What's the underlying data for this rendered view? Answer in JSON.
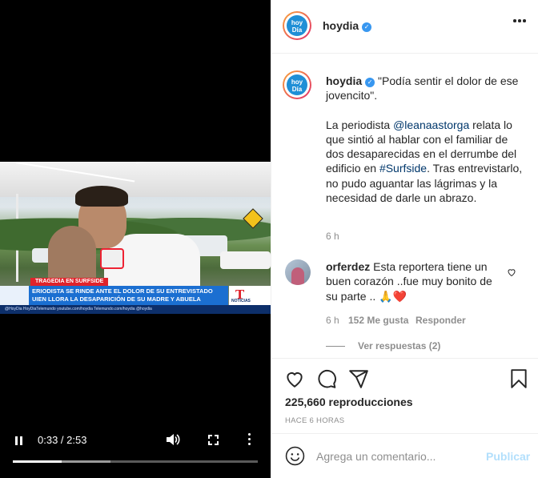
{
  "video": {
    "tag": "TRAGEDIA EN SURFSIDE",
    "headline_1": "ERIODISTA SE RINDE ANTE EL DOLOR DE SU ENTREVISTADO",
    "headline_2": "UIEN LLORA LA DESAPARICIÓN DE SU MADRE Y ABUELA",
    "footer": "@HoyDia   HoyDiaTelemundo   youtube.com/hoydia   Telemundo.com/hoydia   @hoydia",
    "network_logo": "T",
    "network_label": "NOTICIAS",
    "time_display": "0:33 / 2:53",
    "progress": 0.2,
    "buffered": 0.4
  },
  "post_header": {
    "username": "hoydia",
    "avatar_text": "hoy Día",
    "verified_glyph": "✓"
  },
  "caption": {
    "username": "hoydia",
    "quote": "\"Podía sentir el dolor de ese jovencito\".",
    "body_1": "La periodista ",
    "mention": "@leanaastorga",
    "body_2": " relata lo que sintió al hablar con el familiar de dos desaparecidas en el derrumbe del edificio en ",
    "hashtag": "#Surfside",
    "body_3": ". Tras entrevistarlo, no pudo aguantar las lágrimas y la necesidad de darle un abrazo.",
    "time": "6 h"
  },
  "comment": {
    "username": "orferdez",
    "text": "Esta reportera tiene un buen corazón ..fue muy bonito de su parte ..",
    "emojis": "🙏❤️",
    "time": "6 h",
    "likes": "152 Me gusta",
    "reply": "Responder",
    "view_replies": "Ver respuestas (2)"
  },
  "stats": {
    "views": "225,660 reproducciones",
    "ago": "HACE 6 HORAS"
  },
  "comment_box": {
    "placeholder": "Agrega un comentario...",
    "publish": "Publicar"
  },
  "colors": {
    "link": "#00376b",
    "secondary": "#8e8e8e",
    "verified": "#3897f0",
    "publish_disabled": "#b2dffc",
    "heart_red": "#ed4956"
  }
}
